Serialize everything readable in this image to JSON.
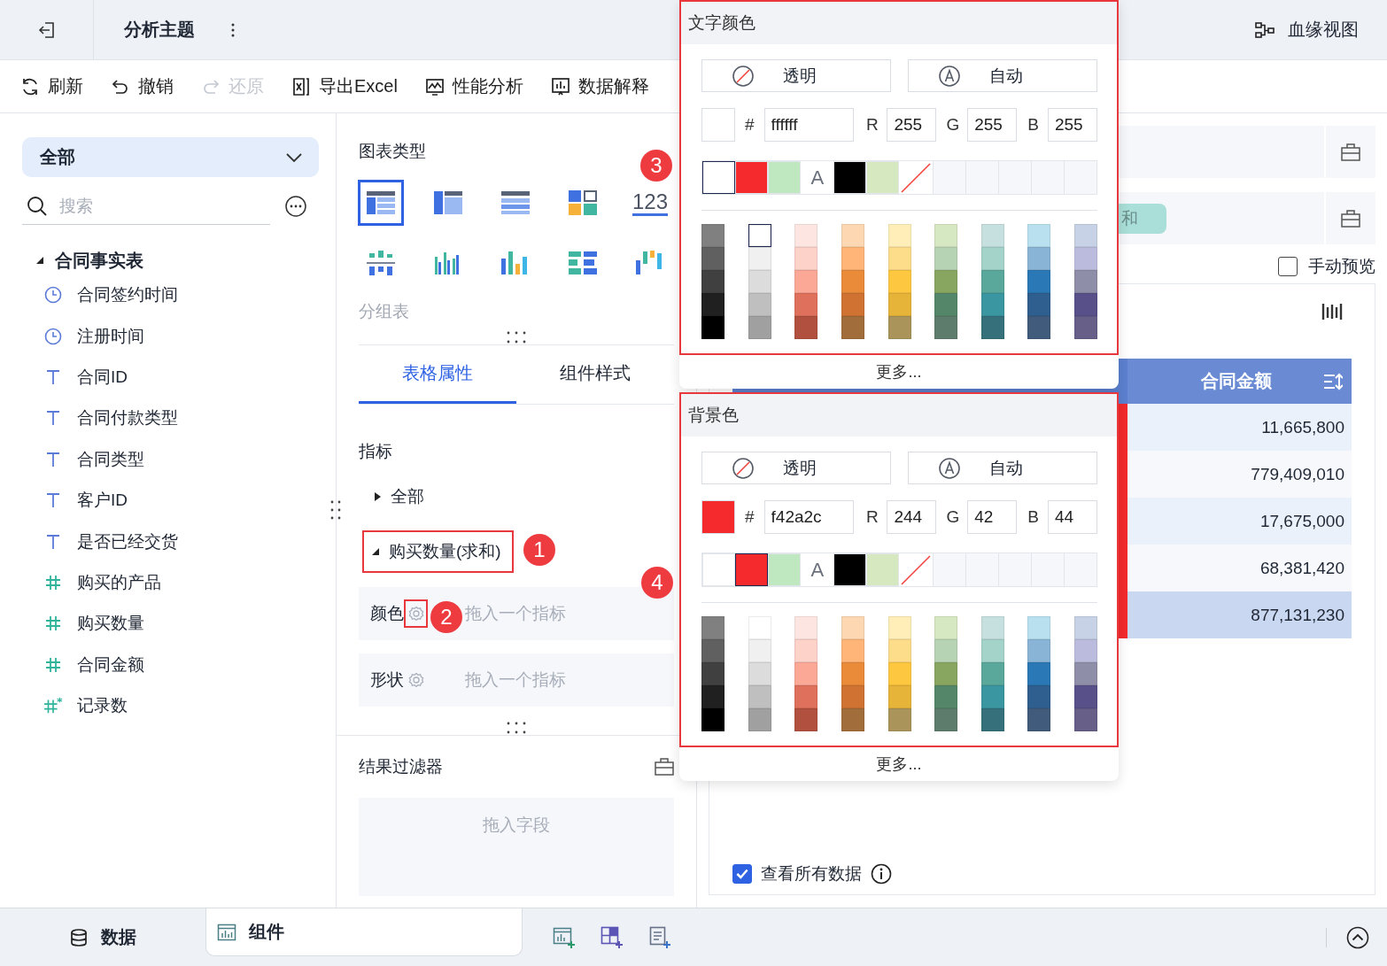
{
  "topbar": {
    "title": "分析主题",
    "lineage": "血缘视图"
  },
  "toolbar": [
    {
      "label": "刷新",
      "disabled": false
    },
    {
      "label": "撤销",
      "disabled": false
    },
    {
      "label": "还原",
      "disabled": true
    },
    {
      "label": "导出Excel",
      "disabled": false
    },
    {
      "label": "性能分析",
      "disabled": false
    },
    {
      "label": "数据解释",
      "disabled": false
    }
  ],
  "sidebar": {
    "dropdown": "全部",
    "search": {
      "placeholder": "搜索"
    },
    "tree": [
      {
        "label": "合同事实表",
        "expanded": true,
        "children": [
          {
            "label": "合同签约时间",
            "kind": "time"
          },
          {
            "label": "注册时间",
            "kind": "time"
          },
          {
            "label": "合同ID",
            "kind": "text"
          },
          {
            "label": "合同付款类型",
            "kind": "text"
          },
          {
            "label": "合同类型",
            "kind": "text"
          },
          {
            "label": "客户ID",
            "kind": "text"
          },
          {
            "label": "是否已经交货",
            "kind": "text"
          },
          {
            "label": "购买的产品",
            "kind": "number"
          },
          {
            "label": "购买数量",
            "kind": "number"
          },
          {
            "label": "合同金额",
            "kind": "number"
          },
          {
            "label": "记录数",
            "kind": "count"
          }
        ]
      }
    ]
  },
  "chart_types": {
    "title": "图表类型",
    "hint": "分组表",
    "items": [
      {
        "kind": "group-table",
        "selected": true
      },
      {
        "kind": "cross-table",
        "selected": false
      },
      {
        "kind": "detail-table",
        "selected": false
      },
      {
        "kind": "card",
        "selected": false
      },
      {
        "kind": "kpi",
        "label": "123",
        "selected": false
      },
      {
        "kind": "grouped-bar",
        "selected": false
      },
      {
        "kind": "multi-bar",
        "selected": false
      },
      {
        "kind": "bar",
        "selected": false
      },
      {
        "kind": "range-bar",
        "selected": false
      },
      {
        "kind": "waterfall",
        "selected": false
      }
    ]
  },
  "tabs": [
    {
      "label": "表格属性",
      "selected": true
    },
    {
      "label": "组件样式",
      "selected": false
    }
  ],
  "metrics": {
    "title": "指标",
    "tree": [
      {
        "label": "全部",
        "expanded": false,
        "highlighted": false
      },
      {
        "label": "购买数量(求和)",
        "expanded": true,
        "highlighted": true
      }
    ],
    "props": [
      {
        "label": "颜色",
        "hint": "拖入一个指标",
        "highlighted": true
      },
      {
        "label": "形状",
        "hint": "拖入一个指标",
        "highlighted": false
      }
    ]
  },
  "filter": {
    "title": "结果过滤器",
    "hint": "拖入字段"
  },
  "color_pickers": [
    {
      "title": "文字颜色",
      "highlighted": true,
      "transparent": "透明",
      "auto": "自动",
      "color": "#ffffff",
      "hex": {
        "label": "#",
        "value": "ffffff"
      },
      "channels": [
        {
          "label": "R",
          "value": "255"
        },
        {
          "label": "G",
          "value": "255"
        },
        {
          "label": "B",
          "value": "255"
        }
      ],
      "recent": [
        {
          "kind": "color",
          "color": "#ffffff",
          "selected": true
        },
        {
          "kind": "color",
          "color": "#f42a2c",
          "selected": false
        },
        {
          "kind": "color",
          "color": "#c0e8c0",
          "selected": false
        },
        {
          "kind": "auto",
          "label": "A",
          "selected": false
        },
        {
          "kind": "color",
          "color": "#000000",
          "selected": false
        },
        {
          "kind": "color",
          "color": "#d5e8c0",
          "selected": false
        },
        {
          "kind": "none",
          "selected": false
        },
        {
          "kind": "empty",
          "selected": false
        },
        {
          "kind": "empty",
          "selected": false
        },
        {
          "kind": "empty",
          "selected": false
        },
        {
          "kind": "empty",
          "selected": false
        },
        {
          "kind": "empty",
          "selected": false
        }
      ],
      "palette": [
        [
          {
            "color": "#808080",
            "selected": false
          },
          {
            "color": "#606060",
            "selected": false
          },
          {
            "color": "#404040",
            "selected": false
          },
          {
            "color": "#202020",
            "selected": false
          },
          {
            "color": "#000000",
            "selected": false
          }
        ],
        [
          {
            "color": "#ffffff",
            "selected": true
          },
          {
            "color": "#f0f0f0",
            "selected": false
          },
          {
            "color": "#dcdcdc",
            "selected": false
          },
          {
            "color": "#bfbfbf",
            "selected": false
          },
          {
            "color": "#a0a0a0",
            "selected": false
          }
        ],
        [
          {
            "color": "#fde6e1",
            "selected": false
          },
          {
            "color": "#fdd2c9",
            "selected": false
          },
          {
            "color": "#fba897",
            "selected": false
          },
          {
            "color": "#df705c",
            "selected": false
          },
          {
            "color": "#b1503f",
            "selected": false
          }
        ],
        [
          {
            "color": "#fdd7b2",
            "selected": false
          },
          {
            "color": "#feb577",
            "selected": false
          },
          {
            "color": "#ea8b3a",
            "selected": false
          },
          {
            "color": "#cf7232",
            "selected": false
          },
          {
            "color": "#a16d3b",
            "selected": false
          }
        ],
        [
          {
            "color": "#ffeeb8",
            "selected": false
          },
          {
            "color": "#fedd8a",
            "selected": false
          },
          {
            "color": "#fdc840",
            "selected": false
          },
          {
            "color": "#e6b438",
            "selected": false
          },
          {
            "color": "#aa9459",
            "selected": false
          }
        ],
        [
          {
            "color": "#d6e8c1",
            "selected": false
          },
          {
            "color": "#b6d3b3",
            "selected": false
          },
          {
            "color": "#89a661",
            "selected": false
          },
          {
            "color": "#548769",
            "selected": false
          },
          {
            "color": "#5d7c6c",
            "selected": false
          }
        ],
        [
          {
            "color": "#c6e0df",
            "selected": false
          },
          {
            "color": "#a4d3ca",
            "selected": false
          },
          {
            "color": "#5aa89b",
            "selected": false
          },
          {
            "color": "#3a96a0",
            "selected": false
          },
          {
            "color": "#36707b",
            "selected": false
          }
        ],
        [
          {
            "color": "#b8e0ef",
            "selected": false
          },
          {
            "color": "#8ab4d5",
            "selected": false
          },
          {
            "color": "#2a79b6",
            "selected": false
          },
          {
            "color": "#2f5f8e",
            "selected": false
          },
          {
            "color": "#405b7b",
            "selected": false
          }
        ],
        [
          {
            "color": "#c7d2e6",
            "selected": false
          },
          {
            "color": "#bbbbdd",
            "selected": false
          },
          {
            "color": "#8e8ea8",
            "selected": false
          },
          {
            "color": "#575089",
            "selected": false
          },
          {
            "color": "#675f88",
            "selected": false
          }
        ]
      ],
      "more": "更多..."
    },
    {
      "title": "背景色",
      "highlighted": true,
      "transparent": "透明",
      "auto": "自动",
      "color": "#f42a2c",
      "hex": {
        "label": "#",
        "value": "f42a2c"
      },
      "channels": [
        {
          "label": "R",
          "value": "244"
        },
        {
          "label": "G",
          "value": "42"
        },
        {
          "label": "B",
          "value": "44"
        }
      ],
      "recent": [
        {
          "kind": "color",
          "color": "#ffffff",
          "selected": false
        },
        {
          "kind": "color",
          "color": "#f42a2c",
          "selected": true
        },
        {
          "kind": "color",
          "color": "#c0e8c0",
          "selected": false
        },
        {
          "kind": "auto",
          "label": "A",
          "selected": false
        },
        {
          "kind": "color",
          "color": "#000000",
          "selected": false
        },
        {
          "kind": "color",
          "color": "#d5e8c0",
          "selected": false
        },
        {
          "kind": "none",
          "selected": false
        },
        {
          "kind": "empty",
          "selected": false
        },
        {
          "kind": "empty",
          "selected": false
        },
        {
          "kind": "empty",
          "selected": false
        },
        {
          "kind": "empty",
          "selected": false
        },
        {
          "kind": "empty",
          "selected": false
        }
      ],
      "palette": [
        [
          {
            "color": "#808080",
            "selected": false
          },
          {
            "color": "#606060",
            "selected": false
          },
          {
            "color": "#404040",
            "selected": false
          },
          {
            "color": "#202020",
            "selected": false
          },
          {
            "color": "#000000",
            "selected": false
          }
        ],
        [
          {
            "color": "#ffffff",
            "selected": false
          },
          {
            "color": "#f0f0f0",
            "selected": false
          },
          {
            "color": "#dcdcdc",
            "selected": false
          },
          {
            "color": "#bfbfbf",
            "selected": false
          },
          {
            "color": "#a0a0a0",
            "selected": false
          }
        ],
        [
          {
            "color": "#fde6e1",
            "selected": false
          },
          {
            "color": "#fdd2c9",
            "selected": false
          },
          {
            "color": "#fba897",
            "selected": false
          },
          {
            "color": "#df705c",
            "selected": false
          },
          {
            "color": "#b1503f",
            "selected": false
          }
        ],
        [
          {
            "color": "#fdd7b2",
            "selected": false
          },
          {
            "color": "#feb577",
            "selected": false
          },
          {
            "color": "#ea8b3a",
            "selected": false
          },
          {
            "color": "#cf7232",
            "selected": false
          },
          {
            "color": "#a16d3b",
            "selected": false
          }
        ],
        [
          {
            "color": "#ffeeb8",
            "selected": false
          },
          {
            "color": "#fedd8a",
            "selected": false
          },
          {
            "color": "#fdc840",
            "selected": false
          },
          {
            "color": "#e6b438",
            "selected": false
          },
          {
            "color": "#aa9459",
            "selected": false
          }
        ],
        [
          {
            "color": "#d6e8c1",
            "selected": false
          },
          {
            "color": "#b6d3b3",
            "selected": false
          },
          {
            "color": "#89a661",
            "selected": false
          },
          {
            "color": "#548769",
            "selected": false
          },
          {
            "color": "#5d7c6c",
            "selected": false
          }
        ],
        [
          {
            "color": "#c6e0df",
            "selected": false
          },
          {
            "color": "#a4d3ca",
            "selected": false
          },
          {
            "color": "#5aa89b",
            "selected": false
          },
          {
            "color": "#3a96a0",
            "selected": false
          },
          {
            "color": "#36707b",
            "selected": false
          }
        ],
        [
          {
            "color": "#b8e0ef",
            "selected": false
          },
          {
            "color": "#8ab4d5",
            "selected": false
          },
          {
            "color": "#2a79b6",
            "selected": false
          },
          {
            "color": "#2f5f8e",
            "selected": false
          },
          {
            "color": "#405b7b",
            "selected": false
          }
        ],
        [
          {
            "color": "#c7d2e6",
            "selected": false
          },
          {
            "color": "#bbbbdd",
            "selected": false
          },
          {
            "color": "#8e8ea8",
            "selected": false
          },
          {
            "color": "#575089",
            "selected": false
          },
          {
            "color": "#675f88",
            "selected": false
          }
        ]
      ],
      "more": "更多..."
    }
  ],
  "canvas": {
    "chip": "和",
    "manual_preview": {
      "label": "手动预览",
      "checked": false
    },
    "table": {
      "column": "合同金额",
      "rows": [
        {
          "value": "11,665,800",
          "selected": false
        },
        {
          "value": "779,409,010",
          "selected": false
        },
        {
          "value": "17,675,000",
          "selected": false
        },
        {
          "value": "68,381,420",
          "selected": false
        },
        {
          "value": "877,131,230",
          "selected": true
        }
      ]
    },
    "view_all": {
      "label": "查看所有数据",
      "checked": true
    }
  },
  "bottom_tabs": [
    {
      "label": "数据",
      "selected": false
    },
    {
      "label": "组件",
      "selected": true
    }
  ],
  "annotations": [
    {
      "label": "1"
    },
    {
      "label": "2"
    },
    {
      "label": "3"
    },
    {
      "label": "4"
    }
  ]
}
